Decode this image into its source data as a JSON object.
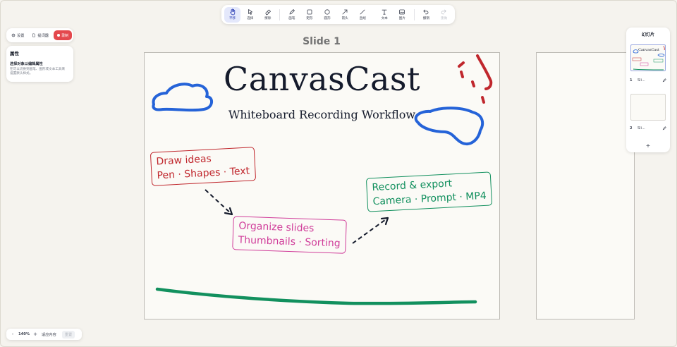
{
  "toolbar": {
    "tools": [
      {
        "id": "hand",
        "label": "平移",
        "icon": "hand-icon"
      },
      {
        "id": "select",
        "label": "选择",
        "icon": "cursor-icon"
      },
      {
        "id": "eraser",
        "label": "擦除",
        "icon": "eraser-icon"
      },
      {
        "id": "pen",
        "label": "画笔",
        "icon": "pen-icon"
      },
      {
        "id": "rect",
        "label": "矩形",
        "icon": "square-icon"
      },
      {
        "id": "ellipse",
        "label": "圆形",
        "icon": "circle-icon"
      },
      {
        "id": "arrow",
        "label": "箭头",
        "icon": "arrow-icon"
      },
      {
        "id": "line",
        "label": "直线",
        "icon": "line-icon"
      },
      {
        "id": "text",
        "label": "文本",
        "icon": "text-icon"
      },
      {
        "id": "image",
        "label": "图片",
        "icon": "image-icon"
      },
      {
        "id": "undo",
        "label": "撤销",
        "icon": "undo-icon"
      },
      {
        "id": "redo",
        "label": "重做",
        "icon": "redo-icon"
      }
    ],
    "active_tool": "hand"
  },
  "left_buttons": {
    "settings": "设置",
    "prompter": "提词器",
    "record": "录制"
  },
  "properties": {
    "heading": "属性",
    "title": "选择对象以编辑属性",
    "description_line1": "在可以切换到画笔、图形或文本工具来",
    "description_line2": "设置默认样式。"
  },
  "slide_label": "Slide 1",
  "slide": {
    "title": "CanvasCast",
    "subtitle": "Whiteboard Recording Workflow",
    "notes": {
      "red_line1": "Draw ideas",
      "red_line2": "Pen · Shapes · Text",
      "pink_line1": "Organize slides",
      "pink_line2": "Thumbnails · Sorting",
      "green_line1": "Record & export",
      "green_line2": "Camera · Prompt · MP4"
    }
  },
  "slides_panel": {
    "title": "幻灯片",
    "slides": [
      {
        "number": "1",
        "name": "Sli..."
      },
      {
        "number": "2",
        "name": "Sli..."
      }
    ],
    "thumb_title": "CanvasCast",
    "add_label": "+"
  },
  "zoom": {
    "minus": "-",
    "level": "140%",
    "plus": "+",
    "fit": "适应内容",
    "reset": "重置"
  },
  "colors": {
    "accent": "#2d3fb5",
    "record": "#e4484d",
    "ink_blue": "#2563d8",
    "ink_red": "#c0272d",
    "ink_pink": "#d03d9a",
    "ink_green": "#12905e"
  }
}
